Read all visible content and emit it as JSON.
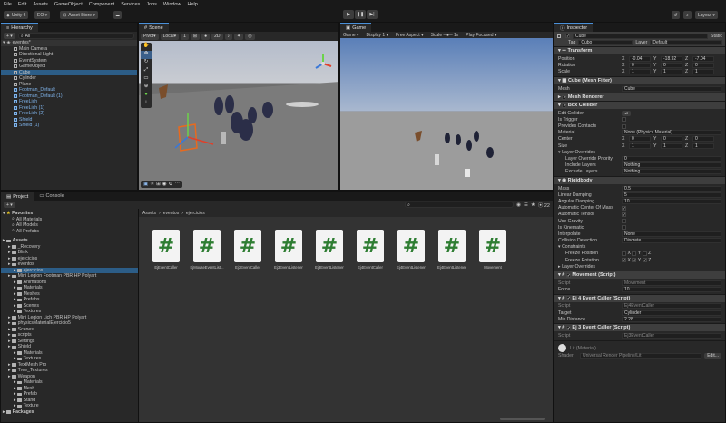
{
  "menu": [
    "File",
    "Edit",
    "Assets",
    "GameObject",
    "Component",
    "Services",
    "Jobs",
    "Window",
    "Help"
  ],
  "toolbar": {
    "unity_version": "Unity 6",
    "account": "EO",
    "asset_store": "Asset Store",
    "layout": "Layout"
  },
  "hierarchy": {
    "tab": "Hierarchy",
    "search_placeholder": "All",
    "scene": "eventos*",
    "items": [
      {
        "label": "Main Camera",
        "indent": 2,
        "type": "object"
      },
      {
        "label": "Directional Light",
        "indent": 2,
        "type": "object"
      },
      {
        "label": "EventSystem",
        "indent": 2,
        "type": "object"
      },
      {
        "label": "GameObject",
        "indent": 2,
        "type": "object"
      },
      {
        "label": "Cube",
        "indent": 2,
        "type": "object",
        "selected": true
      },
      {
        "label": "Cylinder",
        "indent": 2,
        "type": "object"
      },
      {
        "label": "Plane",
        "indent": 2,
        "type": "object"
      },
      {
        "label": "Footman_Default",
        "indent": 2,
        "type": "prefab"
      },
      {
        "label": "Footman_Default (1)",
        "indent": 2,
        "type": "prefab"
      },
      {
        "label": "FreeLich",
        "indent": 2,
        "type": "prefab"
      },
      {
        "label": "FreeLich (1)",
        "indent": 2,
        "type": "prefab"
      },
      {
        "label": "FreeLich (2)",
        "indent": 2,
        "type": "prefab"
      },
      {
        "label": "Shield",
        "indent": 2,
        "type": "prefab"
      },
      {
        "label": "Shield (1)",
        "indent": 2,
        "type": "prefab"
      }
    ]
  },
  "scene": {
    "tab": "Scene",
    "pivot": "Pivot",
    "local": "Local",
    "mode_2d": "2D",
    "snap": "1"
  },
  "game": {
    "tab": "Game",
    "display_mode": "Game",
    "display": "Display 1",
    "aspect": "Free Aspect",
    "scale_label": "Scale",
    "scale_value": "1x",
    "play_mode": "Play Focused"
  },
  "project": {
    "tabs": [
      "Project",
      "Console"
    ],
    "breadcrumb": [
      "Assets",
      "eventos",
      "ejercicios"
    ],
    "count": "22",
    "favorites": {
      "label": "Favorites",
      "items": [
        "All Materials",
        "All Models",
        "All Prefabs"
      ]
    },
    "tree": [
      {
        "label": "Assets",
        "indent": 0
      },
      {
        "label": "_Recovery",
        "indent": 1
      },
      {
        "label": "Blink",
        "indent": 1
      },
      {
        "label": "ejercicios",
        "indent": 1
      },
      {
        "label": "eventos",
        "indent": 1
      },
      {
        "label": "ejercicios",
        "indent": 2,
        "selected": true
      },
      {
        "label": "Mini Legion Footman PBR HP Polyart",
        "indent": 1
      },
      {
        "label": "Animations",
        "indent": 2
      },
      {
        "label": "Materials",
        "indent": 2
      },
      {
        "label": "Meshes",
        "indent": 2
      },
      {
        "label": "Prefabs",
        "indent": 2
      },
      {
        "label": "Scenes",
        "indent": 2
      },
      {
        "label": "Textures",
        "indent": 2
      },
      {
        "label": "Mini Legion Lich PBR HP Polyart",
        "indent": 1
      },
      {
        "label": "physicsMaterialEjercicio5",
        "indent": 1
      },
      {
        "label": "Scenes",
        "indent": 1
      },
      {
        "label": "scripts",
        "indent": 1
      },
      {
        "label": "Settings",
        "indent": 1
      },
      {
        "label": "Shield",
        "indent": 1
      },
      {
        "label": "Materials",
        "indent": 2
      },
      {
        "label": "Textures",
        "indent": 2
      },
      {
        "label": "TextMesh Pro",
        "indent": 1
      },
      {
        "label": "Tree_Textures",
        "indent": 1
      },
      {
        "label": "Weapon",
        "indent": 1
      },
      {
        "label": "Materials",
        "indent": 2
      },
      {
        "label": "Mesh",
        "indent": 2
      },
      {
        "label": "Prefab",
        "indent": 2
      },
      {
        "label": "Stand",
        "indent": 2
      },
      {
        "label": "Texture",
        "indent": 2
      },
      {
        "label": "Packages",
        "indent": 0
      }
    ],
    "assets": [
      "EjEventCaller",
      "EjMouseEventList...",
      "Ej3EventCaller",
      "Ej3EventListener",
      "Ej3EventListener",
      "Ej4EventCaller",
      "Ej4EventListener",
      "Ej4EventListener",
      "Movement"
    ]
  },
  "inspector": {
    "tab": "Inspector",
    "object_name": "Cube",
    "static_label": "Static",
    "tag_label": "Tag",
    "tag": "Cubo",
    "layer_label": "Layer",
    "layer": "Default",
    "transform": {
      "title": "Transform",
      "rows": [
        {
          "label": "Position",
          "x": "-0.04",
          "y": "-18.92",
          "z": "-7.04"
        },
        {
          "label": "Rotation",
          "x": "0",
          "y": "0",
          "z": "0"
        },
        {
          "label": "Scale",
          "x": "1",
          "y": "1",
          "z": "1"
        }
      ]
    },
    "mesh_filter": {
      "title": "Cube (Mesh Filter)",
      "mesh_label": "Mesh",
      "mesh": "Cube"
    },
    "mesh_renderer": {
      "title": "Mesh Renderer"
    },
    "box_collider": {
      "title": "Box Collider",
      "edit_collider": "Edit Collider",
      "is_trigger": "Is Trigger",
      "provides_contacts": "Provides Contacts",
      "material_label": "Material",
      "material": "None (Physics Material)",
      "center": {
        "label": "Center",
        "x": "0",
        "y": "0",
        "z": "0"
      },
      "size": {
        "label": "Size",
        "x": "1",
        "y": "1",
        "z": "1"
      },
      "layer_overrides": "Layer Overrides",
      "priority_label": "Layer Override Priority",
      "priority": "0",
      "include_label": "Include Layers",
      "include": "Nothing",
      "exclude_label": "Exclude Layers",
      "exclude": "Nothing"
    },
    "rigidbody": {
      "title": "Rigidbody",
      "rows": [
        {
          "label": "Mass",
          "value": "0.5"
        },
        {
          "label": "Linear Damping",
          "value": "5"
        },
        {
          "label": "Angular Damping",
          "value": "10"
        }
      ],
      "checks": [
        {
          "label": "Automatic Center Of Mass",
          "checked": true
        },
        {
          "label": "Automatic Tensor",
          "checked": true
        },
        {
          "label": "Use Gravity",
          "checked": false
        },
        {
          "label": "Is Kinematic",
          "checked": false
        }
      ],
      "interpolate_label": "Interpolate",
      "interpolate": "None",
      "collision_label": "Collision Detection",
      "collision": "Discrete",
      "constraints": "Constraints",
      "freeze_pos": "Freeze Position",
      "freeze_rot": "Freeze Rotation",
      "layer_overrides": "Layer Overrides"
    },
    "movement": {
      "title": "Movement (Script)",
      "script_label": "Script",
      "script": "Movement",
      "force_label": "Force",
      "force": "10"
    },
    "ej4": {
      "title": "Ej 4 Event Caller (Script)",
      "script_label": "Script",
      "script": "Ej4EventCaller",
      "target_label": "Target",
      "target": "Cylinder",
      "min_label": "Min Distance",
      "min": "2.28"
    },
    "ej3": {
      "title": "Ej 3 Event Caller (Script)",
      "script_label": "Script",
      "script": "Ej3EventCaller"
    },
    "material": {
      "name": "Lit (Material)",
      "shader_label": "Shader",
      "shader": "Universal Render Pipeline/Lit",
      "edit": "Edit..."
    }
  },
  "colors": {
    "accent": "#4a90d9",
    "selection": "#2c5d87",
    "prefab_text": "#7fb3ea",
    "script_green": "#2e7d32"
  }
}
